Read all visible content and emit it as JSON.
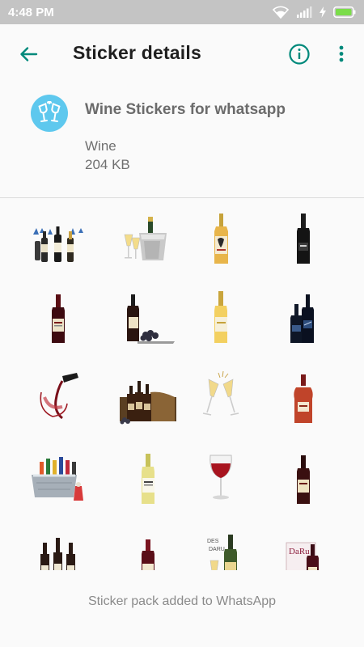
{
  "status_bar": {
    "time": "4:48 PM",
    "icons": [
      "wifi-icon",
      "signal-icon",
      "charging-icon",
      "battery-icon"
    ]
  },
  "app_bar": {
    "title": "Sticker details",
    "back_icon": "arrow-back-icon",
    "info_icon": "info-icon",
    "more_icon": "more-vert-icon",
    "accent_color": "#00897b"
  },
  "pack": {
    "name": "Wine Stickers for whatsapp",
    "publisher": "Wine",
    "size": "204 KB",
    "icon": "wine-glasses-toast-icon",
    "icon_color": "#5ec8ee"
  },
  "stickers": [
    "three-wine-bottles-sticker",
    "champagne-bucket-sticker",
    "yellow-label-bottle-sticker",
    "dark-bottle-sticker",
    "red-wine-bottle-sticker",
    "bottle-with-grapes-sticker",
    "white-wine-bottle-sticker",
    "two-dark-bottles-sticker",
    "wine-pour-sticker",
    "bottles-barrel-sticker",
    "champagne-toast-sticker",
    "cognac-bottle-sticker",
    "ice-tub-bottles-sticker",
    "white-label-bottle-sticker",
    "red-wine-glass-sticker",
    "bordeaux-bottle-sticker",
    "three-bottles-sticker",
    "red-wine-small-sticker",
    "champagne-glass-bottle-sticker",
    "label-card-bottle-sticker"
  ],
  "footer": {
    "message": "Sticker pack added to WhatsApp"
  }
}
